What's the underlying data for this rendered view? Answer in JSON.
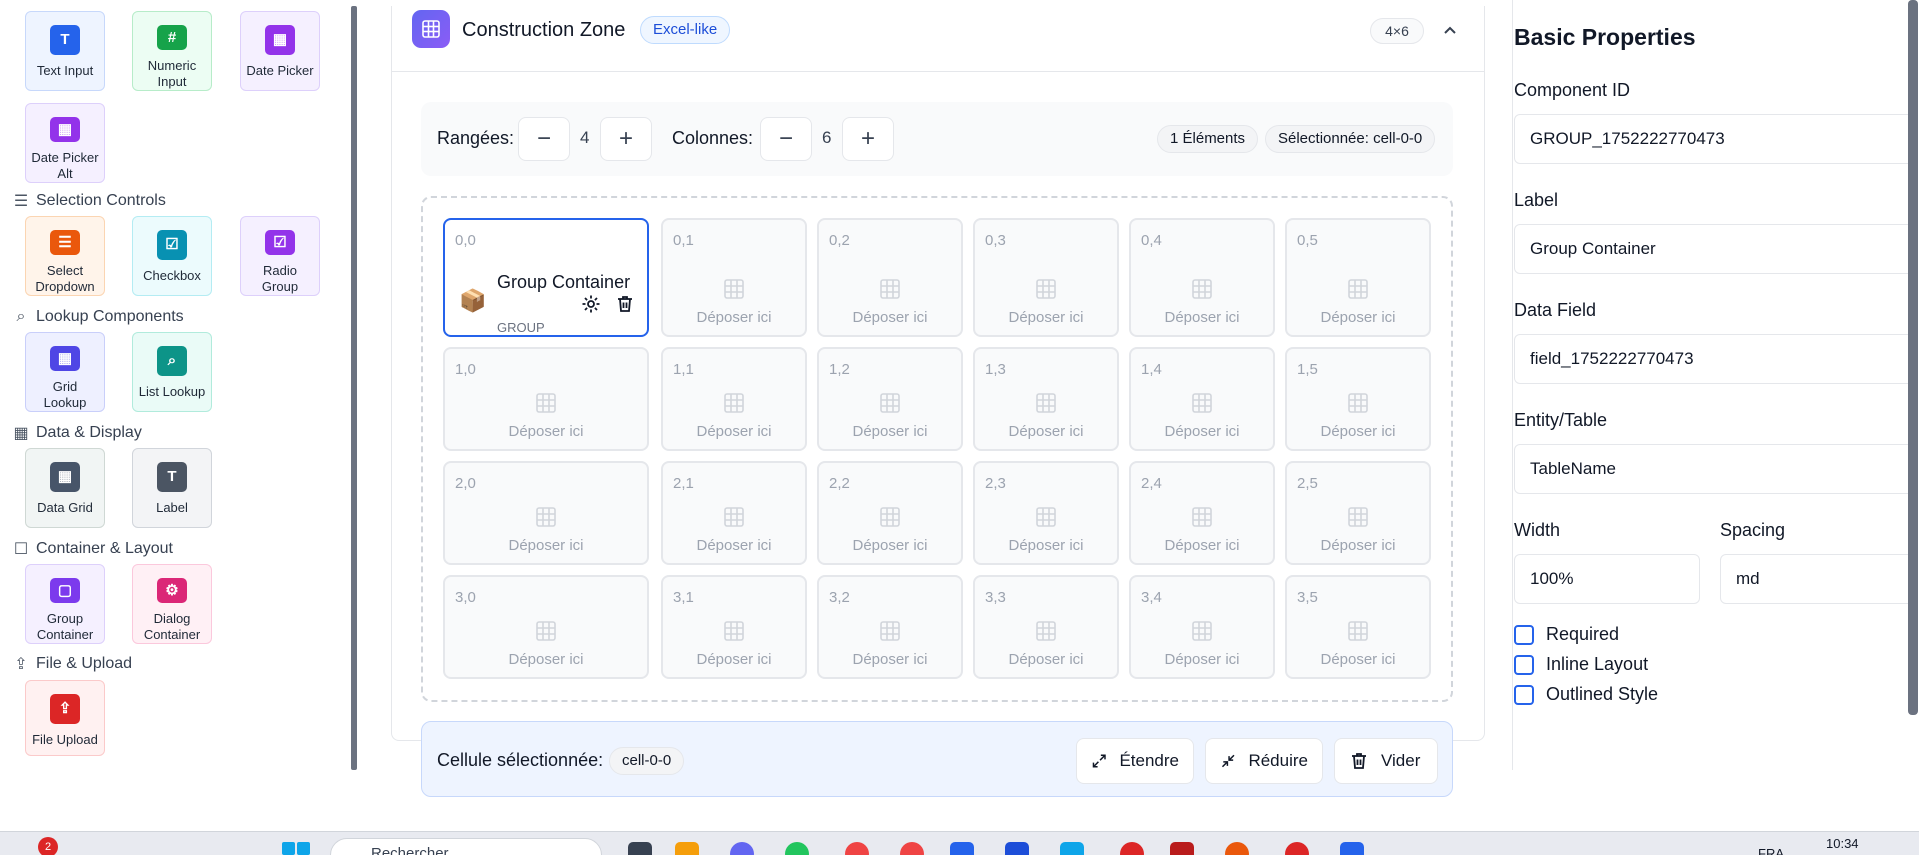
{
  "palette": {
    "sections": [
      {
        "title": "Selection Controls",
        "icon": "list-icon"
      },
      {
        "title": "Lookup Components",
        "icon": "search-icon"
      },
      {
        "title": "Data & Display",
        "icon": "grid-icon"
      },
      {
        "title": "Container & Layout",
        "icon": "square-icon"
      },
      {
        "title": "File & Upload",
        "icon": "upload-icon"
      }
    ],
    "items": [
      {
        "label": "Text Input",
        "glyph": "T",
        "color": "blue"
      },
      {
        "label": "Numeric Input",
        "glyph": "#",
        "color": "green"
      },
      {
        "label": "Date Picker",
        "glyph": "▦",
        "color": "purple"
      },
      {
        "label": "Date Picker Alt",
        "glyph": "▦",
        "color": "purple"
      },
      {
        "label": "Select Dropdown",
        "glyph": "☰",
        "color": "orange"
      },
      {
        "label": "Checkbox",
        "glyph": "☑",
        "color": "cyan"
      },
      {
        "label": "Radio Group",
        "glyph": "☑",
        "color": "violet"
      },
      {
        "label": "Grid Lookup",
        "glyph": "▦",
        "color": "indigo"
      },
      {
        "label": "List Lookup",
        "glyph": "⌕",
        "color": "teal"
      },
      {
        "label": "Data Grid",
        "glyph": "▦",
        "color": "slate"
      },
      {
        "label": "Label",
        "glyph": "T",
        "color": "gray"
      },
      {
        "label": "Group Container",
        "glyph": "▢",
        "color": "violet"
      },
      {
        "label": "Dialog Container",
        "glyph": "⚙",
        "color": "pink"
      },
      {
        "label": "File Upload",
        "glyph": "⇪",
        "color": "red"
      }
    ]
  },
  "zone": {
    "title": "Construction Zone",
    "tag": "Excel-like",
    "size": "4×6"
  },
  "toolbar": {
    "rows_label": "Rangées:",
    "rows_value": "4",
    "cols_label": "Colonnes:",
    "cols_value": "6",
    "minus": "−",
    "plus": "+",
    "elements": "1 Éléments",
    "selected": "Sélectionnée: cell-0-0"
  },
  "grid": {
    "drop_text": "Déposer ici",
    "rows": [
      [
        "0,0",
        "0,1",
        "0,2",
        "0,3",
        "0,4",
        "0,5"
      ],
      [
        "1,0",
        "1,1",
        "1,2",
        "1,3",
        "1,4",
        "1,5"
      ],
      [
        "2,0",
        "2,1",
        "2,2",
        "2,3",
        "2,4",
        "2,5"
      ],
      [
        "3,0",
        "3,1",
        "3,2",
        "3,3",
        "3,4",
        "3,5"
      ]
    ],
    "selected_component": {
      "title": "Group Container",
      "type": "GROUP",
      "icon": "📦"
    }
  },
  "selection_bar": {
    "label": "Cellule sélectionnée:",
    "cell": "cell-0-0",
    "expand": "Étendre",
    "shrink": "Réduire",
    "clear": "Vider"
  },
  "properties": {
    "title": "Basic Properties",
    "component_id_label": "Component ID",
    "component_id": "GROUP_1752222770473",
    "label_label": "Label",
    "label_value": "Group Container",
    "data_field_label": "Data Field",
    "data_field": "field_1752222770473",
    "entity_label": "Entity/Table",
    "entity": "TableName",
    "width_label": "Width",
    "width": "100%",
    "spacing_label": "Spacing",
    "spacing": "md",
    "required": "Required",
    "inline_layout": "Inline Layout",
    "outlined_style": "Outlined Style"
  },
  "taskbar": {
    "notification_count": "2",
    "search_placeholder": "Rechercher",
    "time": "10:34",
    "lang": "FRA"
  }
}
